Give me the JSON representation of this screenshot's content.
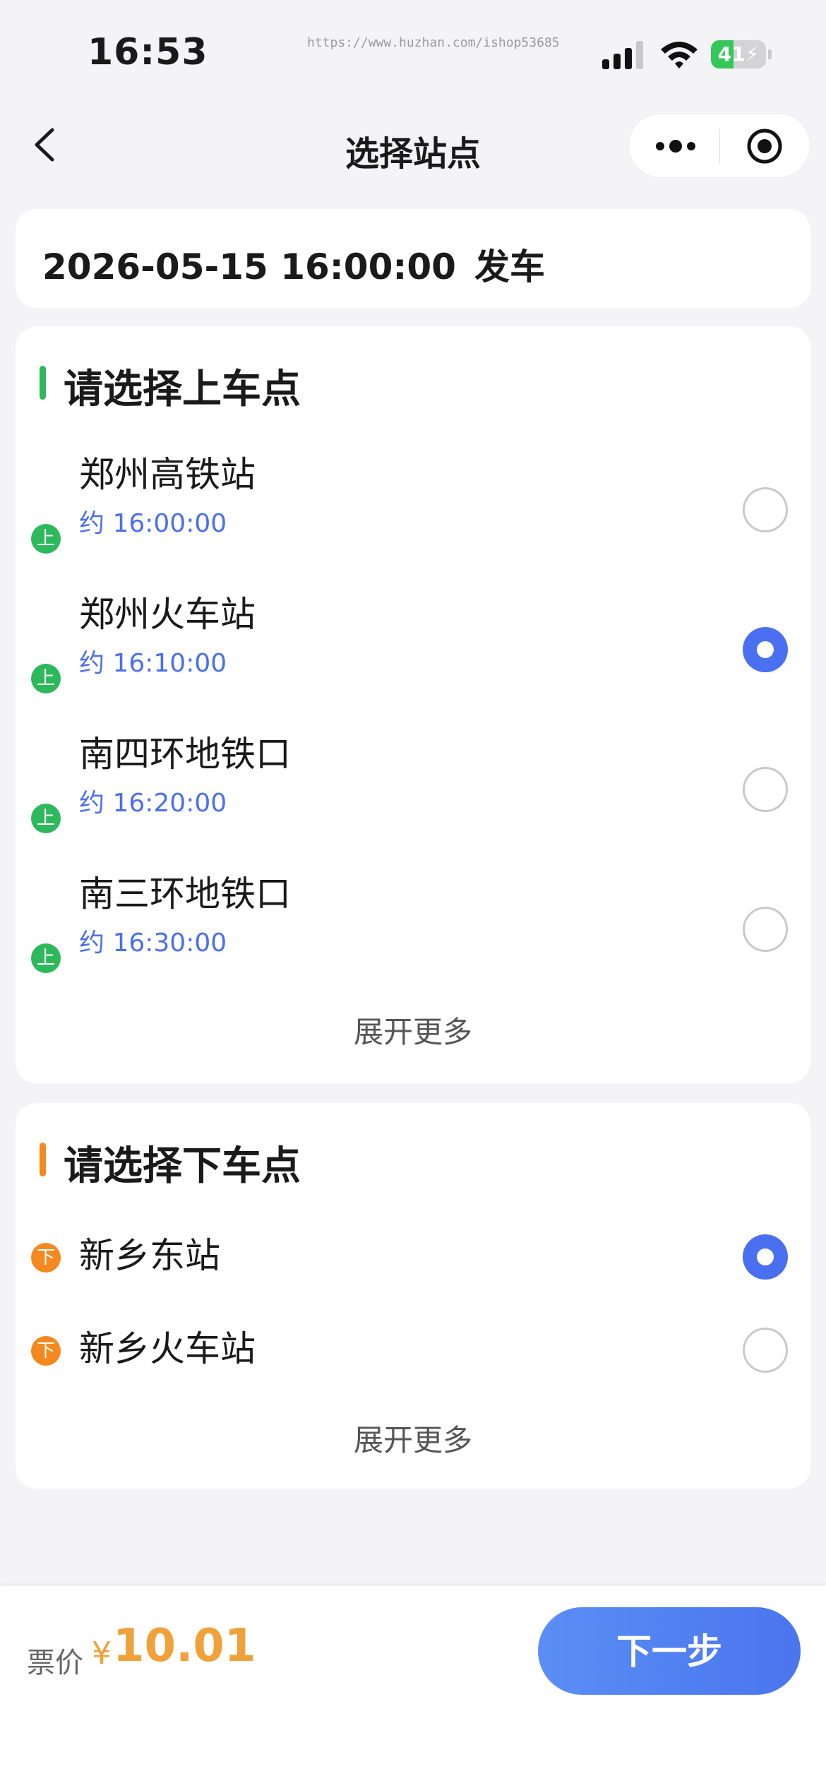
{
  "status_bar": {
    "time": "16:53",
    "url": "https://www.huzhan.com/ishop53685",
    "battery": "41",
    "battery_level": 0.41
  },
  "nav": {
    "title": "选择站点",
    "icons": [
      "back-icon",
      "more-icon",
      "target-icon"
    ]
  },
  "departure": {
    "datetime": "2026-05-15 16:00:00",
    "suffix": "发车"
  },
  "boarding": {
    "title": "请选择上车点",
    "tag": "上",
    "accent": "#2eb85c",
    "stations": [
      {
        "name": "郑州高铁站",
        "eta": "约 16:00:00",
        "selected": false
      },
      {
        "name": "郑州火车站",
        "eta": "约 16:10:00",
        "selected": true
      },
      {
        "name": "南四环地铁口",
        "eta": "约 16:20:00",
        "selected": false
      },
      {
        "name": "南三环地铁口",
        "eta": "约 16:30:00",
        "selected": false
      }
    ],
    "expand": "展开更多"
  },
  "alighting": {
    "title": "请选择下车点",
    "tag": "下",
    "accent": "#f5891f",
    "stations": [
      {
        "name": "新乡东站",
        "selected": true
      },
      {
        "name": "新乡火车站",
        "selected": false
      }
    ],
    "expand": "展开更多"
  },
  "footer": {
    "price_label": "票价",
    "currency": "¥",
    "price": "10.01",
    "next_label": "下一步"
  },
  "colors": {
    "primary": "#4a6ff0",
    "price": "#f0a13a",
    "background": "#f4f4f6"
  }
}
